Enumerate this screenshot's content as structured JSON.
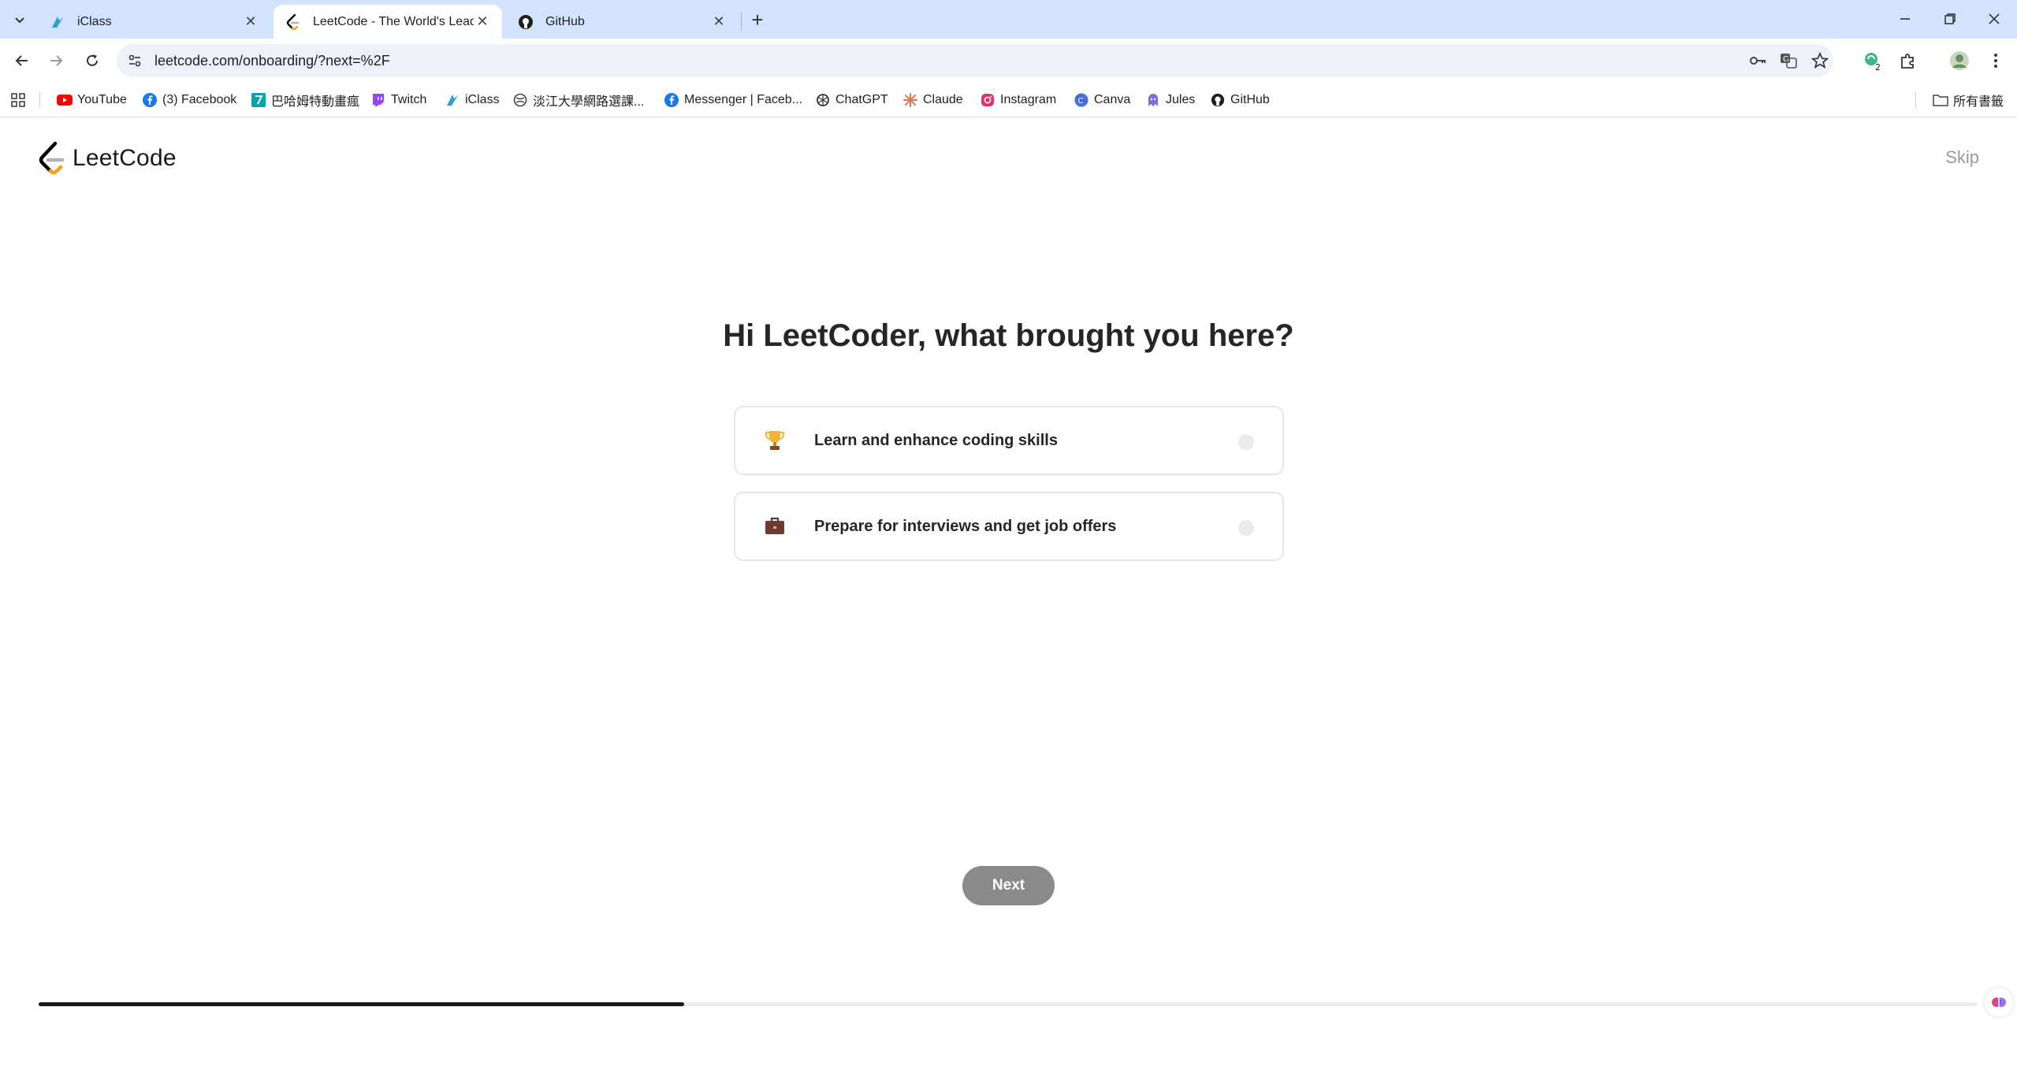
{
  "browser": {
    "tabs": [
      {
        "title": "iClass",
        "active": false,
        "icon": "iclass-icon"
      },
      {
        "title": "LeetCode - The World's Leadi",
        "active": true,
        "icon": "leetcode-icon"
      },
      {
        "title": "GitHub",
        "active": false,
        "icon": "github-icon"
      }
    ],
    "url": "leetcode.com/onboarding/?next=%2F",
    "extension_badge": "2",
    "bookmarks": [
      {
        "label": "YouTube",
        "icon": "youtube-icon"
      },
      {
        "label": "(3) Facebook",
        "icon": "facebook-icon"
      },
      {
        "label": "巴哈姆特動畫瘋",
        "icon": "bahamut-icon"
      },
      {
        "label": "Twitch",
        "icon": "twitch-icon"
      },
      {
        "label": "iClass",
        "icon": "iclass-icon"
      },
      {
        "label": "淡江大學網路選課...",
        "icon": "globe-icon"
      },
      {
        "label": "Messenger | Faceb...",
        "icon": "facebook-icon"
      },
      {
        "label": "ChatGPT",
        "icon": "chatgpt-icon"
      },
      {
        "label": "Claude",
        "icon": "claude-icon"
      },
      {
        "label": "Instagram",
        "icon": "instagram-icon"
      },
      {
        "label": "Canva",
        "icon": "canva-icon"
      },
      {
        "label": "Jules",
        "icon": "jules-icon"
      },
      {
        "label": "GitHub",
        "icon": "github-icon"
      }
    ],
    "all_bookmarks_label": "所有書籤"
  },
  "page": {
    "logo_text": "LeetCode",
    "skip_label": "Skip",
    "heading": "Hi LeetCoder, what brought you here?",
    "options": [
      {
        "label": "Learn and enhance coding skills",
        "icon": "trophy-icon",
        "selected": false
      },
      {
        "label": "Prepare for interviews and get job offers",
        "icon": "briefcase-icon",
        "selected": false
      }
    ],
    "next_label": "Next",
    "progress": 0.333
  },
  "colors": {
    "tabstrip": "#d3e3fd",
    "next_button": "#8a8a8a",
    "progress_fill": "#1a1a1a",
    "skip_text": "#9a9a9a"
  }
}
